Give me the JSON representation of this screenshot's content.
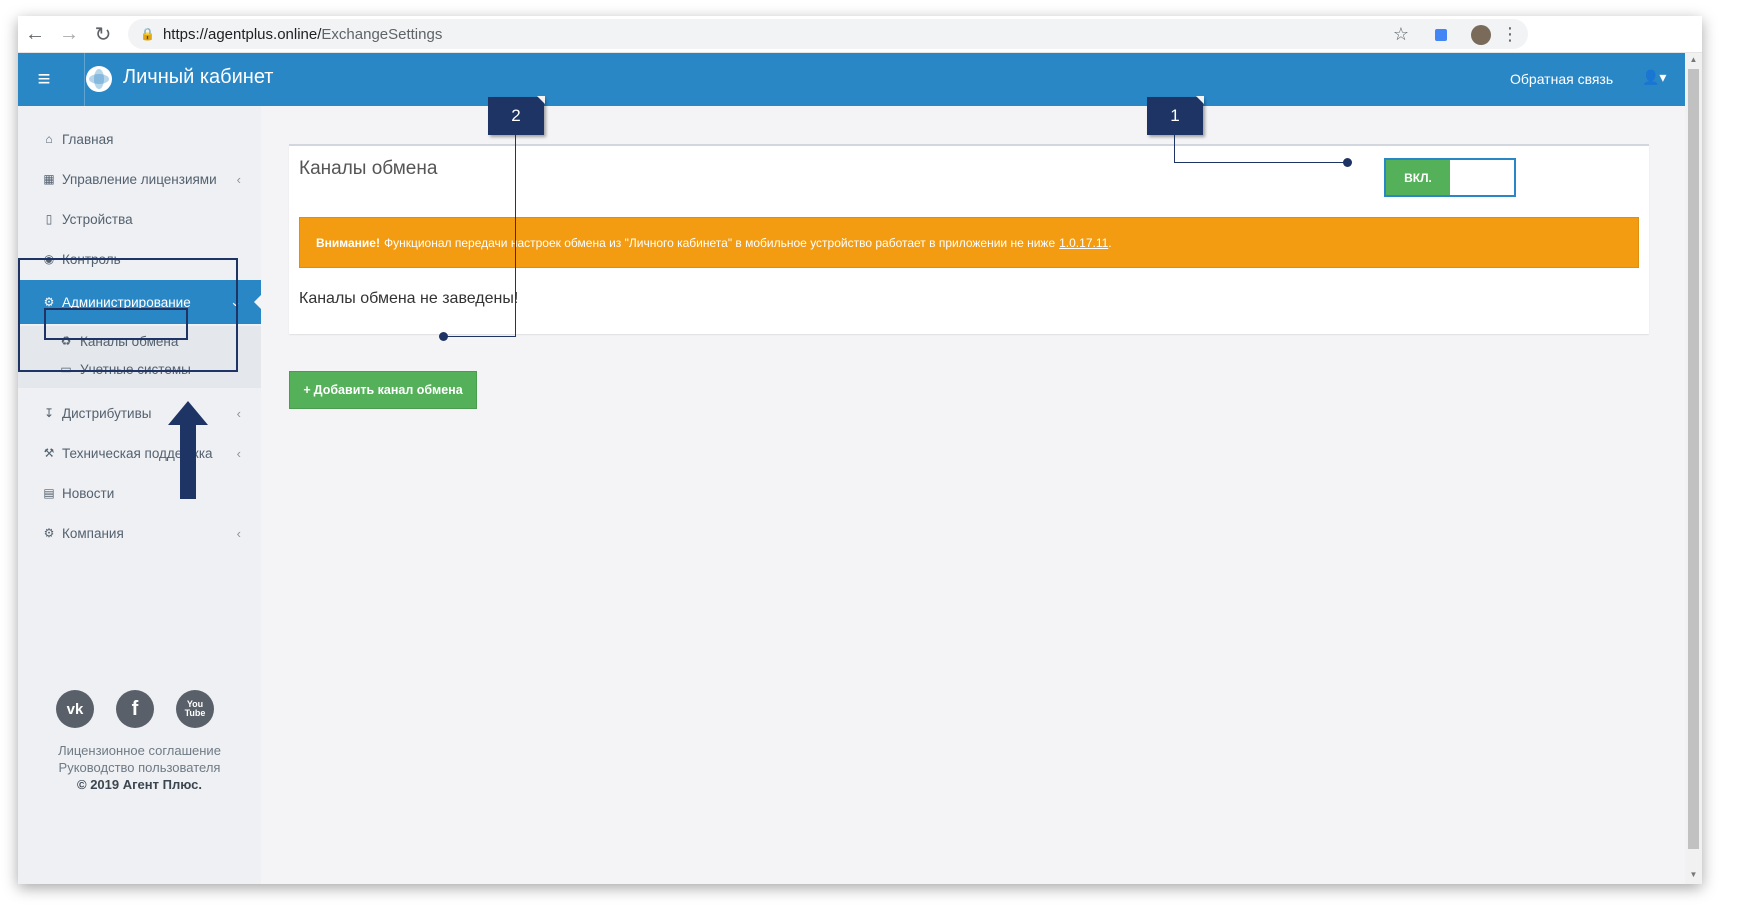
{
  "browser": {
    "url_host": "https://agentplus.online/",
    "url_path": "ExchangeSettings"
  },
  "header": {
    "title": "Личный кабинет",
    "feedback": "Обратная связь",
    "color": "#2a87c6"
  },
  "sidebar": {
    "items": [
      {
        "label": "Главная",
        "icon": "home-icon"
      },
      {
        "label": "Управление лицензиями",
        "icon": "sitemap-icon"
      },
      {
        "label": "Устройства",
        "icon": "mobile-icon"
      },
      {
        "label": "Контроль",
        "icon": "globe-icon"
      },
      {
        "label": "Администрирование",
        "icon": "cogs-icon"
      },
      {
        "label": "Дистрибутивы",
        "icon": "download-icon"
      },
      {
        "label": "Техническая поддержка",
        "icon": "wrench-icon"
      },
      {
        "label": "Новости",
        "icon": "newspaper-icon"
      },
      {
        "label": "Компания",
        "icon": "gear-icon"
      }
    ],
    "sub_items": [
      {
        "label": "Каналы обмена",
        "icon": "recycle-icon"
      },
      {
        "label": "Учетные системы",
        "icon": "monitor-icon"
      }
    ],
    "social": [
      "vk",
      "f",
      "You Tube"
    ],
    "footer": {
      "license": "Лицензионное соглашение",
      "guide": "Руководство пользователя",
      "copyright": "© 2019 Агент Плюс."
    }
  },
  "main": {
    "panel_title": "Каналы обмена",
    "toggle_label": "ВКЛ.",
    "alert_strong": "Внимание!",
    "alert_text": "Функционал передачи настроек обмена из \"Личного кабинета\" в мобильное устройство работает в приложении не ниже",
    "alert_version": "1.0.17.11",
    "alert_end": ".",
    "empty_text": "Каналы обмена не заведены!",
    "add_button": "Добавить канал обмена",
    "alert_color": "#f39c12",
    "success_color": "#55b05a"
  },
  "callouts": [
    "1",
    "2"
  ]
}
